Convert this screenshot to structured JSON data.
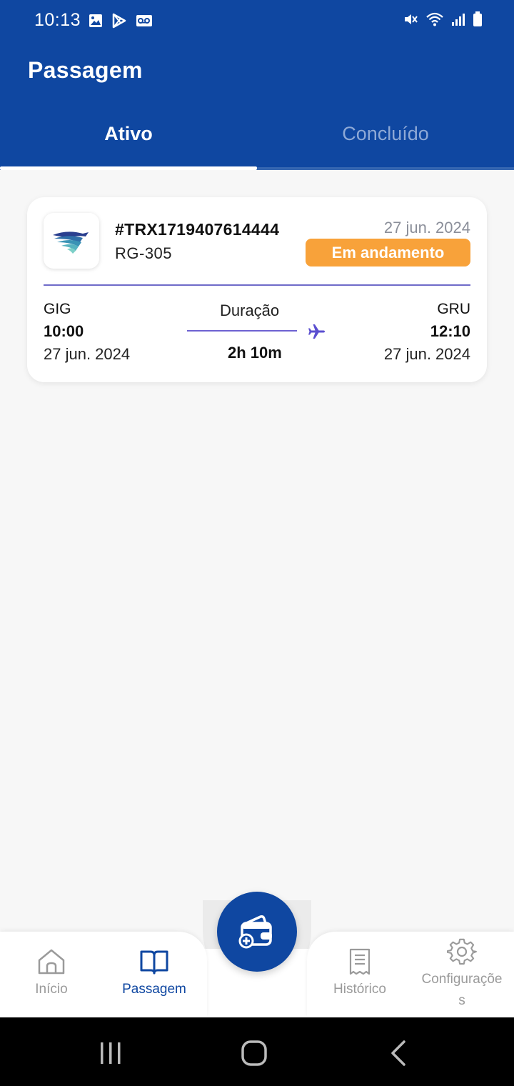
{
  "status_bar": {
    "time": "10:13",
    "left_icons": [
      "image-icon",
      "play-store-icon",
      "voicemail-icon"
    ],
    "right_icons": [
      "mute-icon",
      "wifi-icon",
      "signal-icon",
      "battery-icon"
    ]
  },
  "header": {
    "title": "Passagem",
    "tabs": [
      {
        "label": "Ativo",
        "active": true
      },
      {
        "label": "Concluído",
        "active": false
      }
    ]
  },
  "tickets": [
    {
      "id": "#TRX1719407614444",
      "flight_code": "RG-305",
      "date": "27 jun. 2024",
      "status": "Em andamento",
      "status_color": "#f8a23a",
      "airline_logo_icon": "airline-bird-logo",
      "departure": {
        "code": "GIG",
        "time": "10:00",
        "date": "27 jun. 2024"
      },
      "duration": {
        "label": "Duração",
        "value": "2h 10m"
      },
      "arrival": {
        "code": "GRU",
        "time": "12:10",
        "date": "27 jun. 2024"
      }
    }
  ],
  "bottom_nav": {
    "items": [
      {
        "label": "Início",
        "icon": "home-icon",
        "active": false
      },
      {
        "label": "Passagem",
        "icon": "book-icon",
        "active": true
      },
      {
        "label": "Histórico",
        "icon": "receipt-icon",
        "active": false
      },
      {
        "label": "Configurações",
        "label_line1": "Configuraçõe",
        "label_line2": "s",
        "icon": "gear-icon",
        "active": false
      }
    ],
    "fab_icon": "wallet-add-icon"
  },
  "system_nav": [
    "recent-apps-icon",
    "home-button-icon",
    "back-icon"
  ],
  "colors": {
    "primary": "#0f47a1",
    "accent_line": "#6d62d2",
    "badge": "#f8a23a",
    "background": "#f7f7f7"
  }
}
